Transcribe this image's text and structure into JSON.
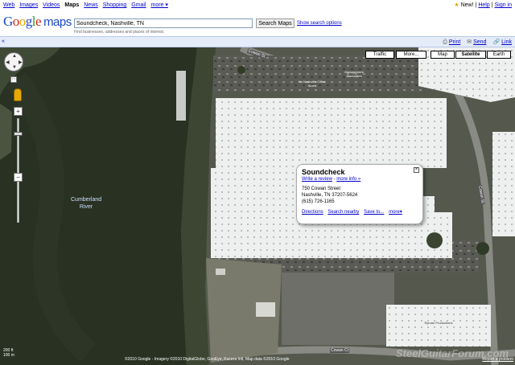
{
  "topnav": {
    "links": [
      "Web",
      "Images",
      "Videos",
      "Maps",
      "News",
      "Shopping",
      "Gmail",
      "more ▾"
    ],
    "active_index": 3,
    "right": {
      "new_star": "★",
      "new": "New!",
      "help": "Help",
      "signin": "Sign in"
    }
  },
  "logo": {
    "google": "Google",
    "maps": "maps"
  },
  "search": {
    "value": "Soundcheck, Nashville, TN",
    "button": "Search Maps",
    "options_link": "Show search options",
    "hint": "Find businesses, addresses and places of interest."
  },
  "toolbar": {
    "collapse": "«",
    "print": "Print",
    "send": "Send",
    "link": "Link"
  },
  "map_types": [
    "Traffic",
    "More...",
    "Map",
    "Satellite",
    "Earth"
  ],
  "selected_map_type": "Satellite",
  "controls": {
    "zoom_in": "+",
    "zoom_out": "−"
  },
  "infowindow": {
    "title": "Soundcheck",
    "write_review": "Write a review",
    "more_info": "more info »",
    "address_line1": "750 Cowan Street",
    "address_line2": "Nashville, TN 37207-5624",
    "phone": "(615) 726-1165",
    "directions": "Directions",
    "search_nearby": "Search nearby",
    "save_to": "Save to...",
    "more": "more▾",
    "close": "×"
  },
  "map_labels": {
    "river_line1": "Cumberland",
    "river_line2": "River",
    "marker_label": "Soundcheck",
    "street_cowan": "Cowan St",
    "street_cowan2": "Cowan Ct",
    "street_side": "Cowan St",
    "biz_nashville_office": "Hz Nashville Office Invest",
    "biz_management": "Management Associates",
    "biz_ryman": "Ryman Productions"
  },
  "footer": {
    "copyright": "©2010 Google - Imagery ©2010 DigitalGlobe, GeoEye, Kucera Intl, Map data ©2010 Google",
    "report": "Report a problem",
    "scale_top": "200 ft",
    "scale_bottom": "100 m",
    "watermark": "SteelGuitarForum.com"
  }
}
